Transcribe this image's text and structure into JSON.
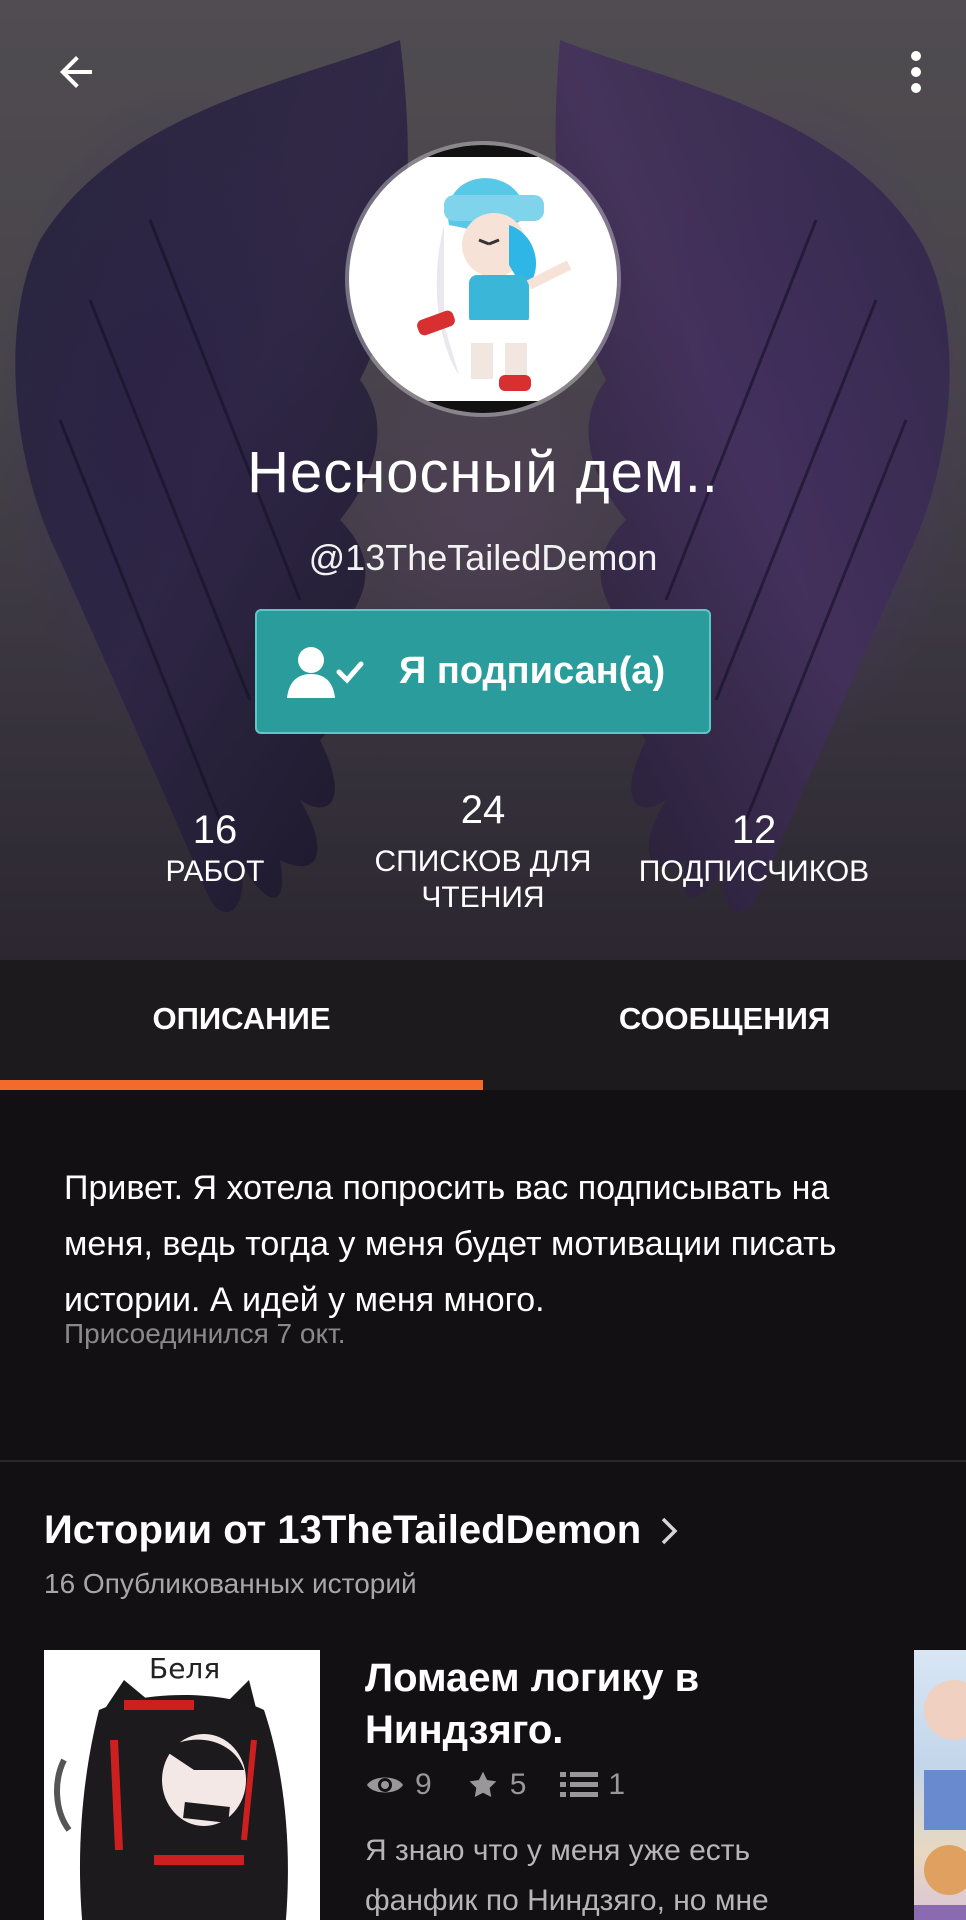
{
  "header": {
    "display_name": "Несносный дем..",
    "username": "@13TheTailedDemon",
    "follow_label": "Я подписан(а)"
  },
  "stats": {
    "works": {
      "value": "16",
      "label": "РАБОТ"
    },
    "reading_lists": {
      "value": "24",
      "label_line1": "СПИСКОВ ДЛЯ",
      "label_line2": "ЧТЕНИЯ"
    },
    "followers": {
      "value": "12",
      "label": "ПОДПИСЧИКОВ"
    }
  },
  "tabs": [
    {
      "label": "ОПИСАНИЕ",
      "active": true
    },
    {
      "label": "СООБЩЕНИЯ",
      "active": false
    }
  ],
  "about": {
    "text": "Привет. Я хотела попросить вас подписывать на меня, ведь тогда у меня будет мотивации писать истории. А идей у меня много.",
    "joined": "Присоединился 7 окт."
  },
  "stories": {
    "title": "Истории от 13TheTailedDemon",
    "count": "16 Опубликованных историй",
    "items": [
      {
        "cover_label": "Беля",
        "title": "Ломаем логику в Ниндзяго.",
        "views": "9",
        "votes": "5",
        "parts": "1",
        "description": "Я знаю что у меня уже есть фанфик по Ниндзяго, но мне"
      }
    ]
  },
  "colors": {
    "accent_teal": "#2b9c9c",
    "tab_indicator": "#f26b2c",
    "background": "#121012"
  },
  "icons": {
    "back": "arrow-left-icon",
    "more": "more-vertical-icon",
    "follow": "user-check-icon",
    "chevron": "chevron-right-icon",
    "views": "eye-icon",
    "votes": "star-icon",
    "parts": "list-icon"
  }
}
